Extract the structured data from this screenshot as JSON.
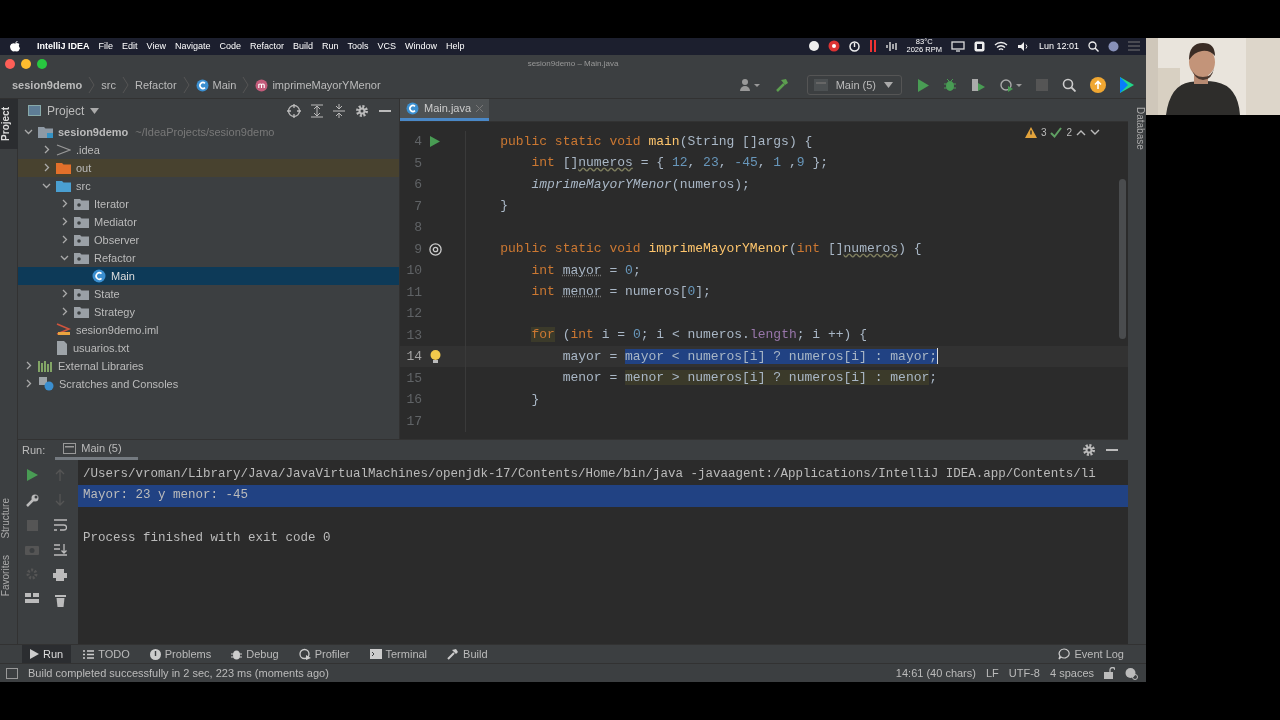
{
  "menubar": {
    "app": "IntelliJ IDEA",
    "menus": [
      "File",
      "Edit",
      "View",
      "Navigate",
      "Code",
      "Refactor",
      "Build",
      "Run",
      "Tools",
      "VCS",
      "Window",
      "Help"
    ],
    "temp": "83°C",
    "rpm": "2026 RPM",
    "clock": "Lun 12:01"
  },
  "window": {
    "title": "sesion9demo – Main.java"
  },
  "breadcrumbs": [
    {
      "label": "sesion9demo",
      "kind": "project"
    },
    {
      "label": "src",
      "kind": "folder"
    },
    {
      "label": "Refactor",
      "kind": "folder"
    },
    {
      "label": "Main",
      "kind": "class"
    },
    {
      "label": "imprimeMayorYMenor",
      "kind": "method"
    }
  ],
  "toolbar": {
    "run_config": "Main (5)"
  },
  "left_stripe": {
    "top": [
      {
        "label": "Project",
        "selected": true
      }
    ],
    "bottom": [
      {
        "label": "Structure",
        "selected": false
      },
      {
        "label": "Favorites",
        "selected": false
      }
    ]
  },
  "project": {
    "title": "Project",
    "tree": [
      {
        "label": "sesion9demo",
        "detail": "~/IdeaProjects/sesion9demo",
        "kind": "module",
        "expanded": true,
        "selected": false,
        "children": [
          {
            "label": ".idea",
            "kind": "config",
            "expanded": false,
            "selected": false
          },
          {
            "label": "out",
            "kind": "excluded",
            "expanded": false,
            "selected": false
          },
          {
            "label": "src",
            "kind": "source",
            "expanded": true,
            "selected": false,
            "children": [
              {
                "label": "Iterator",
                "kind": "package",
                "expanded": false,
                "selected": false
              },
              {
                "label": "Mediator",
                "kind": "package",
                "expanded": false,
                "selected": false
              },
              {
                "label": "Observer",
                "kind": "package",
                "expanded": false,
                "selected": false
              },
              {
                "label": "Refactor",
                "kind": "package",
                "expanded": true,
                "selected": false,
                "children": [
                  {
                    "label": "Main",
                    "kind": "class",
                    "selected": true
                  }
                ]
              },
              {
                "label": "State",
                "kind": "package",
                "expanded": false,
                "selected": false
              },
              {
                "label": "Strategy",
                "kind": "package",
                "expanded": false,
                "selected": false
              }
            ]
          },
          {
            "label": "sesion9demo.iml",
            "kind": "iml",
            "selected": false
          },
          {
            "label": "usuarios.txt",
            "kind": "text",
            "selected": false
          }
        ]
      },
      {
        "label": "External Libraries",
        "kind": "libraries",
        "expanded": false,
        "selected": false
      },
      {
        "label": "Scratches and Consoles",
        "kind": "scratches",
        "expanded": false,
        "selected": false
      }
    ]
  },
  "editor": {
    "tabs": [
      {
        "label": "Main.java",
        "selected": true
      }
    ],
    "warnings": "3",
    "checks": "2",
    "lines": [
      {
        "n": "4",
        "gutter": {
          "kind": "run"
        },
        "current": false,
        "tokens": [
          {
            "text": "    public static void ",
            "kind": "kw"
          },
          {
            "text": "main",
            "kind": "fn"
          },
          {
            "text": "(String []args) {",
            "kind": "plain"
          }
        ]
      },
      {
        "n": "5",
        "current": false,
        "tokens": [
          {
            "text": "        int",
            "kind": "kw"
          },
          {
            "text": " []",
            "kind": "plain"
          },
          {
            "text": "numeros",
            "kind": "warn"
          },
          {
            "text": " = { ",
            "kind": "plain"
          },
          {
            "text": "12",
            "kind": "num"
          },
          {
            "text": ", ",
            "kind": "plain"
          },
          {
            "text": "23",
            "kind": "num"
          },
          {
            "text": ", ",
            "kind": "plain"
          },
          {
            "text": "-45",
            "kind": "num"
          },
          {
            "text": ", ",
            "kind": "plain"
          },
          {
            "text": "1",
            "kind": "num"
          },
          {
            "text": " ,",
            "kind": "plain"
          },
          {
            "text": "9",
            "kind": "num"
          },
          {
            "text": " };",
            "kind": "plain"
          }
        ]
      },
      {
        "n": "6",
        "current": false,
        "tokens": [
          {
            "text": "        imprimeMayorYMenor",
            "kind": "call"
          },
          {
            "text": "(numeros);",
            "kind": "plain"
          }
        ]
      },
      {
        "n": "7",
        "current": false,
        "tokens": [
          {
            "text": "    }",
            "kind": "plain"
          }
        ]
      },
      {
        "n": "8",
        "current": false
      },
      {
        "n": "9",
        "gutter": {
          "kind": "override"
        },
        "current": false,
        "tokens": [
          {
            "text": "    public static void ",
            "kind": "kw"
          },
          {
            "text": "imprimeMayorYMenor",
            "kind": "fn"
          },
          {
            "text": "(",
            "kind": "plain"
          },
          {
            "text": "int",
            "kind": "kw"
          },
          {
            "text": " []",
            "kind": "plain"
          },
          {
            "text": "numeros",
            "kind": "warn"
          },
          {
            "text": ") {",
            "kind": "plain"
          }
        ]
      },
      {
        "n": "10",
        "current": false,
        "tokens": [
          {
            "text": "        int ",
            "kind": "kw"
          },
          {
            "text": "mayor",
            "kind": "local"
          },
          {
            "text": " = ",
            "kind": "plain"
          },
          {
            "text": "0",
            "kind": "num"
          },
          {
            "text": ";",
            "kind": "plain"
          }
        ]
      },
      {
        "n": "11",
        "current": false,
        "tokens": [
          {
            "text": "        int ",
            "kind": "kw"
          },
          {
            "text": "menor",
            "kind": "local"
          },
          {
            "text": " = numeros[",
            "kind": "plain"
          },
          {
            "text": "0",
            "kind": "num"
          },
          {
            "text": "];",
            "kind": "plain"
          }
        ]
      },
      {
        "n": "12",
        "current": false
      },
      {
        "n": "13",
        "current": false,
        "tokens": [
          {
            "text": "        for",
            "kind": "kwmatch"
          },
          {
            "text": " (",
            "kind": "plain"
          },
          {
            "text": "int",
            "kind": "kw"
          },
          {
            "text": " i = ",
            "kind": "plain"
          },
          {
            "text": "0",
            "kind": "num"
          },
          {
            "text": "; i < numeros.",
            "kind": "plain"
          },
          {
            "text": "length",
            "kind": "field"
          },
          {
            "text": "; i ++) {",
            "kind": "plain"
          }
        ]
      },
      {
        "n": "14",
        "gutter": {
          "kind": "bulb"
        },
        "current": true,
        "caret": true,
        "tokens": [
          {
            "text": "            mayor = ",
            "kind": "plain"
          },
          {
            "text": "mayor < numeros[i] ? numeros[i] : mayor;",
            "kind": "sel"
          }
        ]
      },
      {
        "n": "15",
        "current": false,
        "tokens": [
          {
            "text": "            menor = ",
            "kind": "plain"
          },
          {
            "text": "menor > numeros[i] ? numeros[i] : menor",
            "kind": "match"
          },
          {
            "text": ";",
            "kind": "plain"
          }
        ]
      },
      {
        "n": "16",
        "current": false,
        "tokens": [
          {
            "text": "        }",
            "kind": "plain"
          }
        ]
      },
      {
        "n": "17",
        "current": false
      }
    ]
  },
  "right_stripe": [
    "Database"
  ],
  "run": {
    "label": "Run:",
    "tabs": [
      {
        "label": "Main (5)",
        "selected": true
      }
    ],
    "console": [
      {
        "text": "/Users/vroman/Library/Java/JavaVirtualMachines/openjdk-17/Contents/Home/bin/java -javaagent:/Applications/IntelliJ IDEA.app/Contents/li",
        "kind": "command",
        "selected": false
      },
      {
        "text": "Mayor: 23 y menor: -45",
        "kind": "output",
        "selected": true
      },
      {
        "text": "Process finished with exit code 0",
        "kind": "output",
        "selected": false
      }
    ]
  },
  "tool_tabs": [
    {
      "label": "Run",
      "kind": "run",
      "selected": true
    },
    {
      "label": "TODO",
      "kind": "todo",
      "selected": false
    },
    {
      "label": "Problems",
      "kind": "problems",
      "selected": false
    },
    {
      "label": "Debug",
      "kind": "debug",
      "selected": false
    },
    {
      "label": "Profiler",
      "kind": "profiler",
      "selected": false
    },
    {
      "label": "Terminal",
      "kind": "terminal",
      "selected": false
    },
    {
      "label": "Build",
      "kind": "build",
      "selected": false
    }
  ],
  "event_log": "Event Log",
  "status_bar": {
    "message": "Build completed successfully in 2 sec, 223 ms (moments ago)",
    "items": [
      "14:61 (40 chars)",
      "LF",
      "UTF-8",
      "4 spaces"
    ]
  }
}
